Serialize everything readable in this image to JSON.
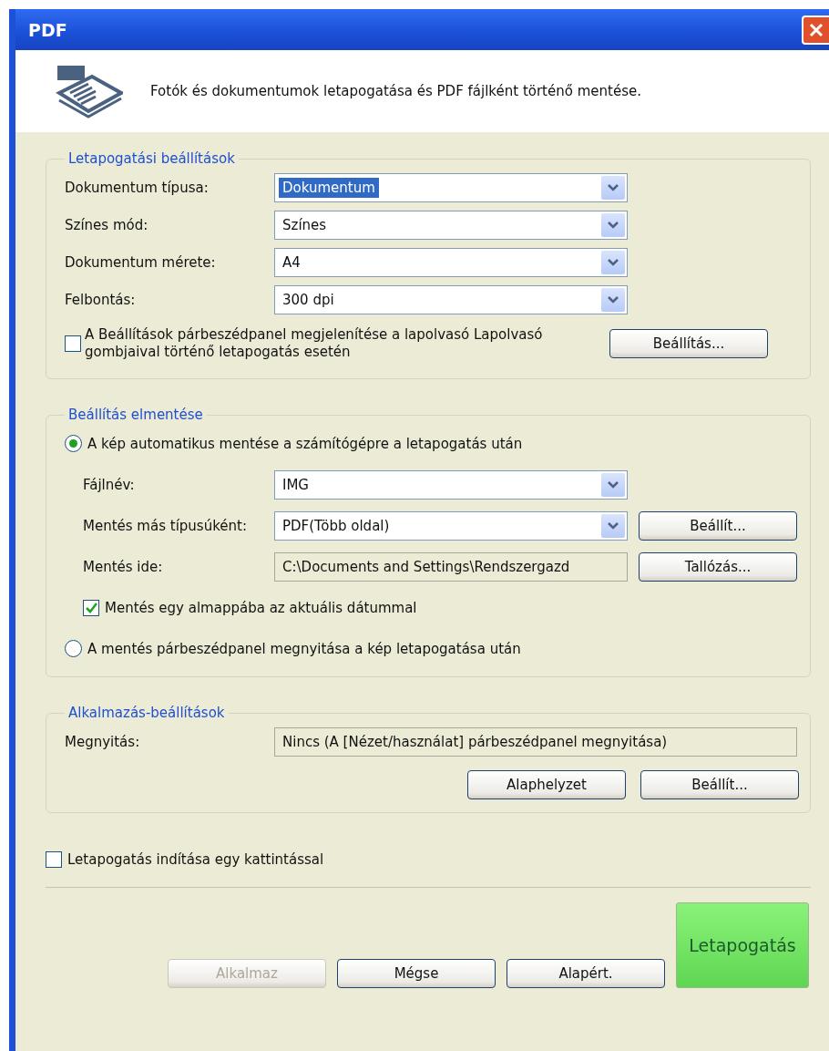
{
  "window": {
    "title": "PDF"
  },
  "header": {
    "description": "Fotók és dokumentumok letapogatása és PDF fájlként történő mentése."
  },
  "scan_settings": {
    "title": "Letapogatási beállítások",
    "fields": [
      {
        "label": "Dokumentum típusa:",
        "value": "Dokumentum",
        "highlighted": true
      },
      {
        "label": "Színes mód:",
        "value": "Színes",
        "highlighted": false
      },
      {
        "label": "Dokumentum mérete:",
        "value": "A4",
        "highlighted": false
      },
      {
        "label": "Felbontás:",
        "value": "300 dpi",
        "highlighted": false
      }
    ],
    "checkbox": {
      "label": "A Beállítások párbeszédpanel megjelenítése a lapolvasó Lapolvasó gombjaival történő letapogatás esetén",
      "checked": false
    },
    "button": "Beállítás..."
  },
  "save_settings": {
    "title": "Beállítás elmentése",
    "auto_save": {
      "label": "A kép automatikus mentése a számítógépre a letapogatás után",
      "selected": true
    },
    "fields": [
      {
        "kind": "dropdown",
        "label": "Fájlnév:",
        "value": "IMG"
      },
      {
        "kind": "dropdown",
        "label": "Mentés más típusúként:",
        "value": "PDF(Több oldal)",
        "button": "Beállít..."
      },
      {
        "kind": "readonly",
        "label": "Mentés ide:",
        "value": "C:\\Documents and Settings\\Rendszergazd",
        "button": "Tallózás..."
      }
    ],
    "subfolder": {
      "label": "Mentés egy almappába az aktuális dátummal",
      "checked": true
    },
    "dialog_save": {
      "label": "A mentés párbeszédpanel megnyitása a kép letapogatása után",
      "selected": false
    }
  },
  "app_settings": {
    "title": "Alkalmazás-beállítások",
    "open_label": "Megnyitás:",
    "open_value": "Nincs (A [Nézet/használat] párbeszédpanel megnyitása)",
    "buttons": [
      "Alaphelyzet",
      "Beállít..."
    ]
  },
  "one_click": {
    "label": "Letapogatás indítása egy kattintással",
    "checked": false
  },
  "buttons": [
    {
      "label": "Alkalmaz",
      "disabled": true
    },
    {
      "label": "Mégse",
      "disabled": false
    },
    {
      "label": "Alapért.",
      "disabled": false
    }
  ],
  "scan_button": "Letapogatás"
}
